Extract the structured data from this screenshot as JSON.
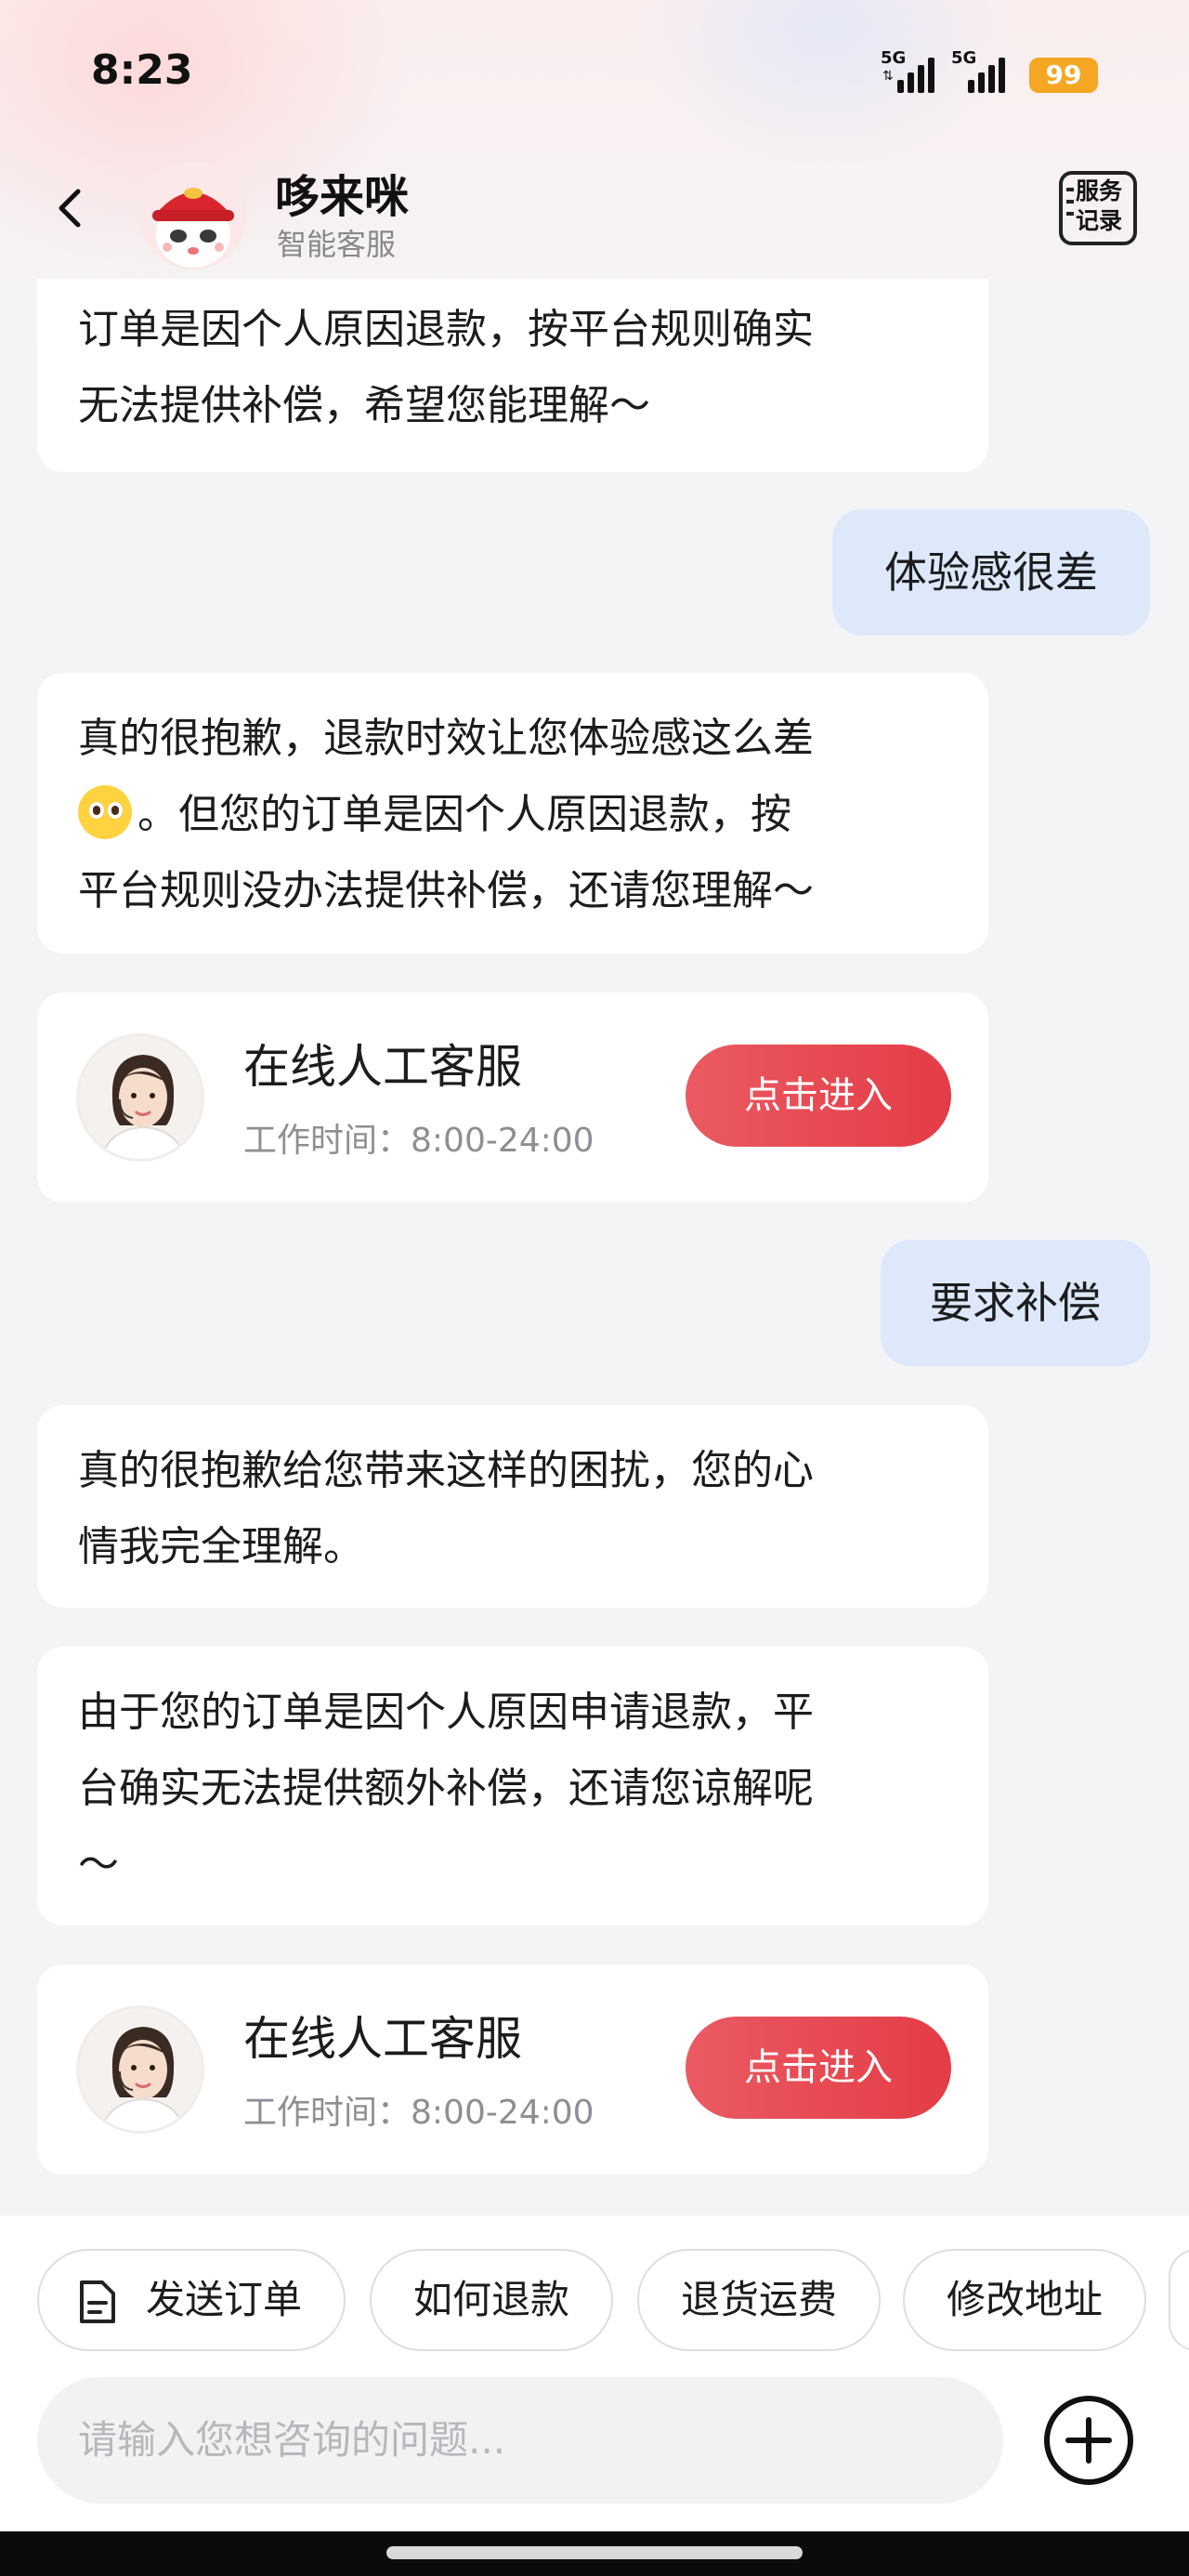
{
  "status_bar": {
    "time": "8:23",
    "network_1": "5G",
    "network_2": "5G",
    "battery": "99"
  },
  "header": {
    "bot_name": "哆来咪",
    "bot_subtitle": "智能客服",
    "records_label_line1": "服务",
    "records_label_line2": "记录"
  },
  "messages": {
    "m1_line1": "订单是因个人原因退款，按平台规则确实",
    "m1_line2": "无法提供补偿，希望您能理解～",
    "m2": "体验感很差",
    "m3_line1": "真的很抱歉，退款时效让您体验感这么差",
    "m3_line2": "。但您的订单是因个人原因退款，按",
    "m3_line3": "平台规则没办法提供补偿，还请您理解～",
    "m4": "要求补偿",
    "m5_line1": "真的很抱歉给您带来这样的困扰，您的心",
    "m5_line2": "情我完全理解。",
    "m6_line1": "由于您的订单是因个人原因申请退款，平",
    "m6_line2": "台确实无法提供额外补偿，还请您谅解呢",
    "m6_line3": "～"
  },
  "service_card": {
    "title": "在线人工客服",
    "hours": "工作时间：8:00-24:00",
    "button_label": "点击进入"
  },
  "quick_replies": [
    "发送订单",
    "如何退款",
    "退货运费",
    "修改地址"
  ],
  "input": {
    "placeholder": "请输入您想咨询的问题..."
  },
  "colors": {
    "accent_red": "#e43c46",
    "user_bubble": "#dde9fb",
    "battery": "#f5a623"
  }
}
